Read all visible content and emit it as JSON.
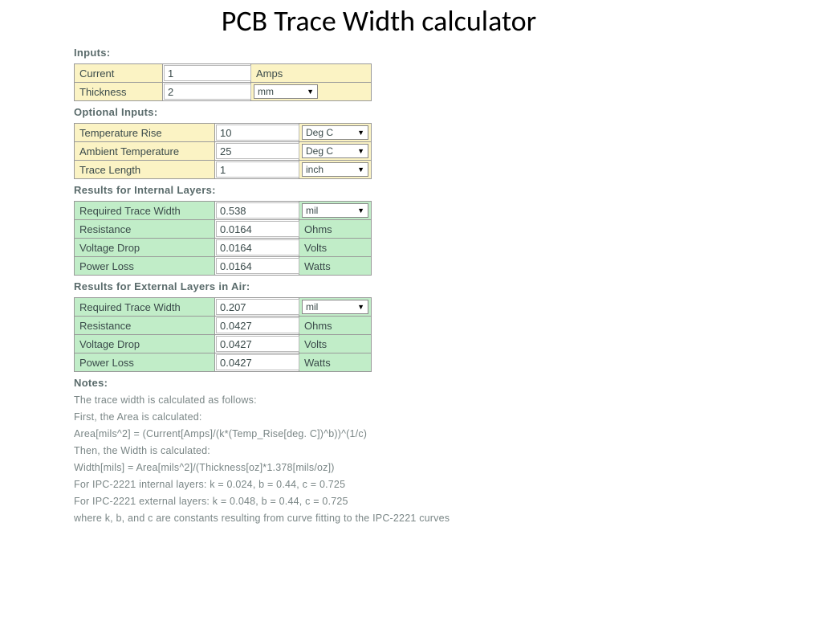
{
  "title": "PCB Trace Width calculator",
  "sections": {
    "inputs_label": "Inputs:",
    "optional_label": "Optional Inputs:",
    "internal_label": "Results for Internal Layers:",
    "external_label": "Results for External Layers in Air:",
    "notes_label": "Notes:"
  },
  "inputs": {
    "current": {
      "label": "Current",
      "value": "1",
      "unit": "Amps"
    },
    "thickness": {
      "label": "Thickness",
      "value": "2",
      "unit": "mm"
    }
  },
  "optional": {
    "temp_rise": {
      "label": "Temperature Rise",
      "value": "10",
      "unit": "Deg C"
    },
    "ambient": {
      "label": "Ambient Temperature",
      "value": "25",
      "unit": "Deg C"
    },
    "trace_len": {
      "label": "Trace Length",
      "value": "1",
      "unit": "inch"
    }
  },
  "internal": {
    "width": {
      "label": "Required Trace Width",
      "value": "0.538",
      "unit": "mil"
    },
    "resistance": {
      "label": "Resistance",
      "value": "0.0164",
      "unit": "Ohms"
    },
    "vdrop": {
      "label": "Voltage Drop",
      "value": "0.0164",
      "unit": "Volts"
    },
    "ploss": {
      "label": "Power Loss",
      "value": "0.0164",
      "unit": "Watts"
    }
  },
  "external": {
    "width": {
      "label": "Required Trace Width",
      "value": "0.207",
      "unit": "mil"
    },
    "resistance": {
      "label": "Resistance",
      "value": "0.0427",
      "unit": "Ohms"
    },
    "vdrop": {
      "label": "Voltage Drop",
      "value": "0.0427",
      "unit": "Volts"
    },
    "ploss": {
      "label": "Power Loss",
      "value": "0.0427",
      "unit": "Watts"
    }
  },
  "notes": [
    "The trace width is calculated as follows:",
    "First, the Area is calculated:",
    "Area[mils^2] = (Current[Amps]/(k*(Temp_Rise[deg. C])^b))^(1/c)",
    "Then, the Width is calculated:",
    "Width[mils] = Area[mils^2]/(Thickness[oz]*1.378[mils/oz])",
    "For IPC-2221 internal layers: k = 0.024, b = 0.44, c = 0.725",
    "For IPC-2221 external layers: k = 0.048, b = 0.44, c = 0.725",
    "where k, b, and c are constants resulting from curve fitting to the IPC-2221 curves"
  ]
}
